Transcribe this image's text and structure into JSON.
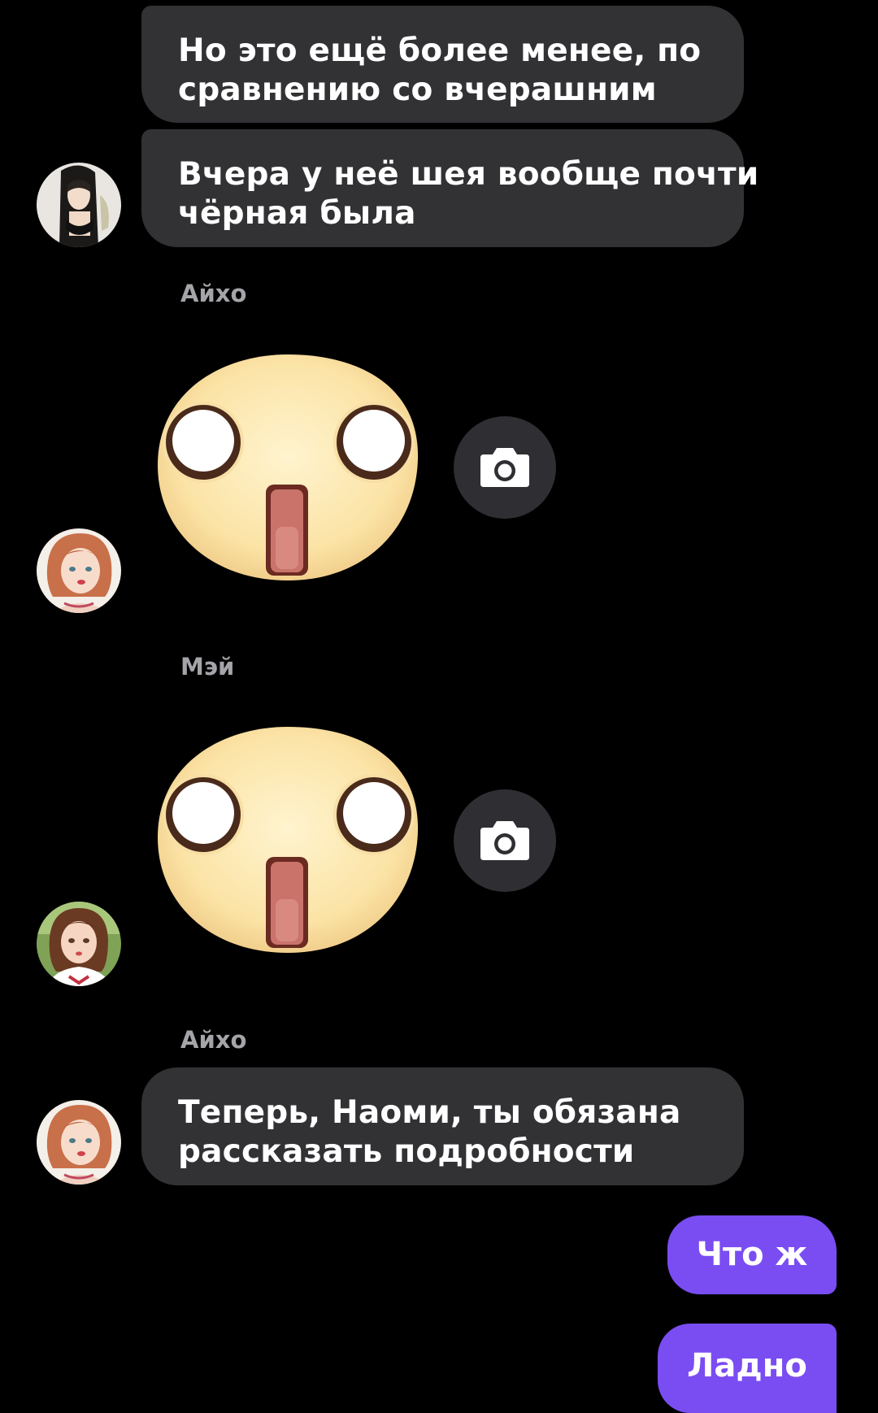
{
  "messages": [
    {
      "type": "text",
      "lines": [
        "Но это ещё более менее, по",
        "сравнению со вчерашним"
      ]
    },
    {
      "type": "text",
      "lines": [
        "Вчера у неё шея вообще почти",
        "чёрная была"
      ]
    },
    {
      "type": "sticker",
      "sender": "Айхо",
      "sticker": "shocked-face-sticker"
    },
    {
      "type": "sticker",
      "sender": "Мэй",
      "sticker": "shocked-face-sticker"
    },
    {
      "type": "text",
      "sender": "Айхо",
      "lines": [
        "Теперь, Наоми, ты обязана",
        "рассказать подробности"
      ]
    }
  ],
  "outgoing": [
    {
      "text": "Что ж"
    },
    {
      "text": "Ладно"
    }
  ],
  "icons": {
    "camera": "camera-icon"
  },
  "colors": {
    "background": "#000000",
    "incoming_bubble": "#323235",
    "outgoing_bubble": "#7a4df2",
    "sender_name": "#a4a4a9"
  }
}
